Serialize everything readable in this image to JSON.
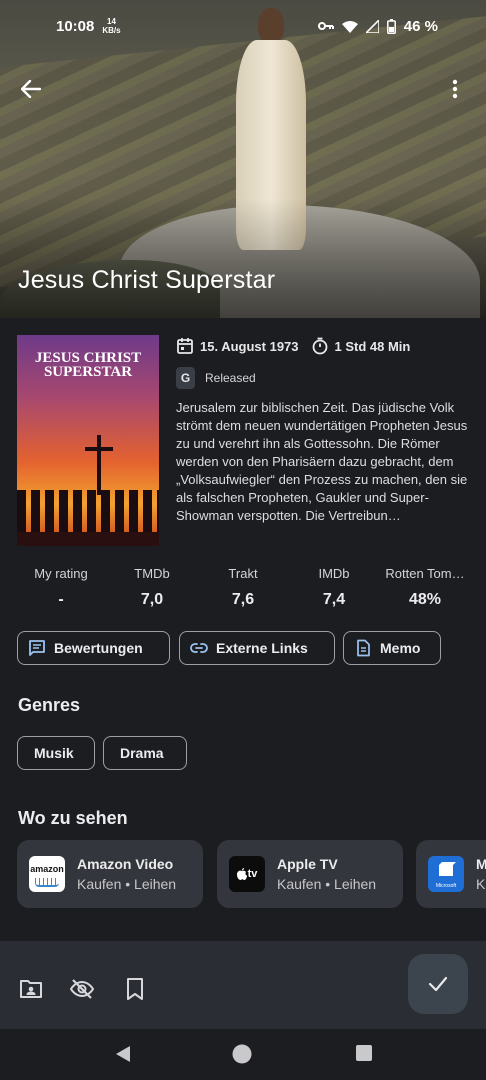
{
  "status_bar": {
    "time": "10:08",
    "speed_value": "14",
    "speed_unit": "KB/s",
    "battery": "46 %"
  },
  "movie": {
    "title": "Jesus Christ Superstar",
    "poster_title": "JESUS CHRIST SUPERSTAR",
    "release_date": "15. August 1973",
    "runtime": "1 Std 48 Min",
    "certification": "G",
    "status": "Released",
    "overview": "Jerusalem zur biblischen Zeit. Das jüdische Volk strömt dem neuen wundertätigen Propheten Jesus zu und verehrt ihn als Gottessohn. Die Römer werden von den Pharisäern dazu gebracht, dem „Volksaufwiegler“ den Prozess zu machen, den sie als falschen Propheten, Gaukler und Super-Showman verspotten. Die Vertreibun…"
  },
  "ratings": [
    {
      "label": "My rating",
      "value": "-"
    },
    {
      "label": "TMDb",
      "value": "7,0"
    },
    {
      "label": "Trakt",
      "value": "7,6"
    },
    {
      "label": "IMDb",
      "value": "7,4"
    },
    {
      "label": "Rotten Tom…",
      "value": "48%"
    }
  ],
  "actions": {
    "reviews": "Bewertungen",
    "external_links": "Externe Links",
    "memo": "Memo"
  },
  "genres": {
    "title": "Genres",
    "items": [
      "Musik",
      "Drama"
    ]
  },
  "watch": {
    "title": "Wo zu sehen",
    "providers": [
      {
        "name": "Amazon Video",
        "sub": "Kaufen • Leihen",
        "logo_text": "amazon"
      },
      {
        "name": "Apple TV",
        "sub": "Kaufen • Leihen",
        "logo_text": "tv"
      },
      {
        "name": "M",
        "sub": "K",
        "logo_text": "Microsoft"
      }
    ]
  },
  "colors": {
    "background": "#1c1d21",
    "surface": "#33363c",
    "bottom_bar": "#2a2d33",
    "fab": "#3c454d"
  }
}
